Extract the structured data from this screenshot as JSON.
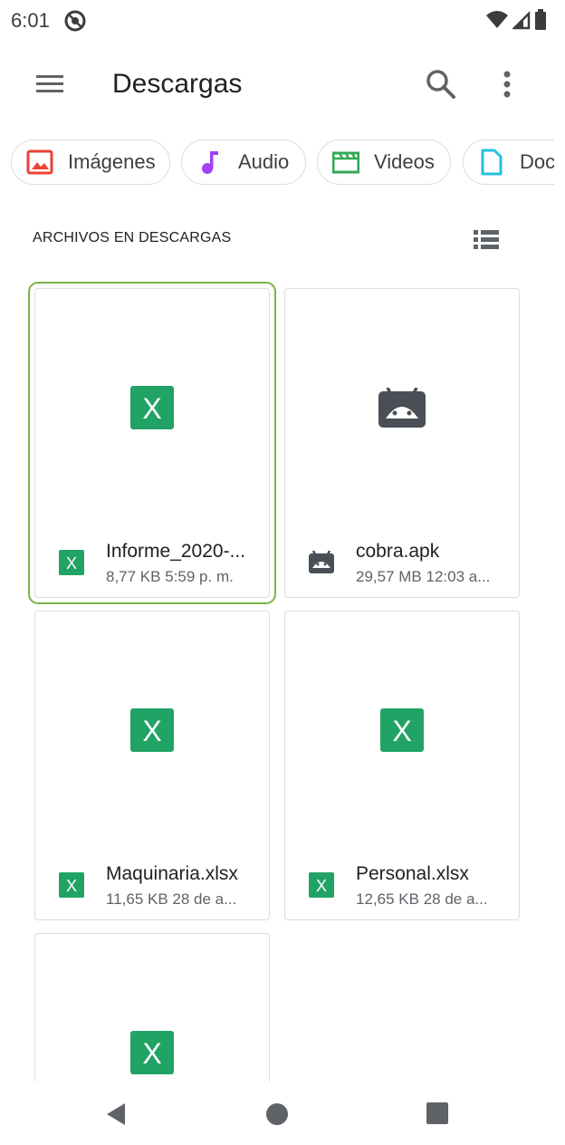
{
  "status_bar": {
    "time": "6:01",
    "icons": [
      "vpn-icon",
      "wifi-icon",
      "signal-icon",
      "battery-icon"
    ]
  },
  "app_bar": {
    "title": "Descargas",
    "icons": [
      "menu-icon",
      "search-icon",
      "more-vert-icon"
    ]
  },
  "chips": [
    {
      "label": "Imágenes",
      "icon": "image-icon",
      "color": "#ea4335"
    },
    {
      "label": "Audio",
      "icon": "music-note-icon",
      "color": "#a142f4"
    },
    {
      "label": "Videos",
      "icon": "video-clapper-icon",
      "color": "#34a853"
    },
    {
      "label": "Doc",
      "icon": "document-icon",
      "color": "#24c1e0"
    }
  ],
  "section": {
    "header": "ARCHIVOS EN DESCARGAS",
    "view_icon": "list-view-icon"
  },
  "files": [
    {
      "name": "Informe_2020-...",
      "size": "8,77 KB",
      "date": "5:59 p. m.",
      "type": "xlsx",
      "selected": true
    },
    {
      "name": "cobra.apk",
      "size": "29,57 MB",
      "date": "12:03 a...",
      "type": "apk",
      "selected": false
    },
    {
      "name": "Maquinaria.xlsx",
      "size": "11,65 KB",
      "date": "28 de a...",
      "type": "xlsx",
      "selected": false
    },
    {
      "name": "Personal.xlsx",
      "size": "12,65 KB",
      "date": "28 de a...",
      "type": "xlsx",
      "selected": false
    },
    {
      "name": "",
      "size": "",
      "date": "",
      "type": "xlsx",
      "selected": false
    }
  ],
  "colors": {
    "excel_green": "#21a366",
    "android_gray": "#4a4f55",
    "selection_outline": "#7cb342"
  },
  "nav_bar": {
    "icons": [
      "back-icon",
      "home-icon",
      "recents-icon"
    ]
  }
}
